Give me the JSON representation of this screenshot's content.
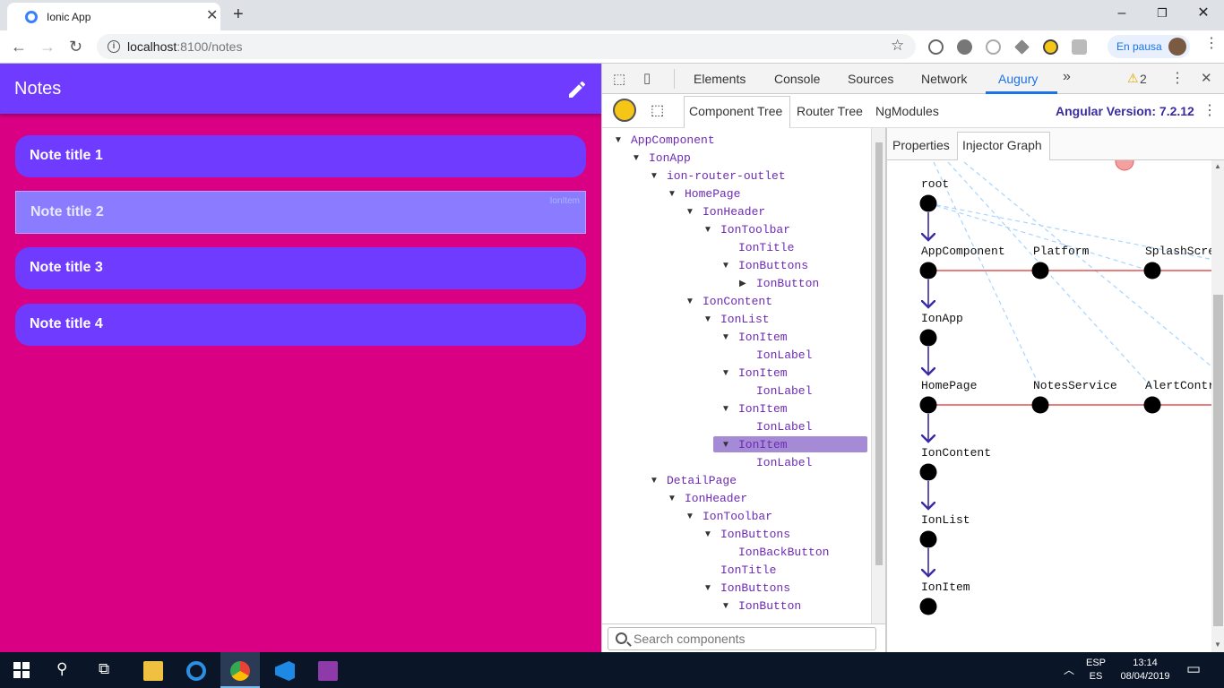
{
  "browser": {
    "tab_title": "Ionic App",
    "url_host": "localhost",
    "url_path": ":8100/notes",
    "profile_status": "En pausa"
  },
  "app": {
    "title": "Notes",
    "notes": [
      "Note title 1",
      "Note title 2",
      "Note title 3",
      "Note title 4"
    ],
    "highlight_tag": "IonItem",
    "colors": {
      "background": "#d90083",
      "toolbar": "#6f3bff",
      "item": "#6f3bff"
    }
  },
  "devtools": {
    "tabs": [
      "Elements",
      "Console",
      "Sources",
      "Network",
      "Augury"
    ],
    "active_tab": "Augury",
    "warning_count": "2",
    "augury_tabs": [
      "Component Tree",
      "Router Tree",
      "NgModules"
    ],
    "angular_version": "Angular Version: 7.2.12",
    "tree": [
      {
        "label": "AppComponent",
        "depth": 0,
        "toggle": "open"
      },
      {
        "label": "IonApp",
        "depth": 1,
        "toggle": "open"
      },
      {
        "label": "ion-router-outlet",
        "depth": 2,
        "toggle": "open"
      },
      {
        "label": "HomePage",
        "depth": 3,
        "toggle": "open"
      },
      {
        "label": "IonHeader",
        "depth": 4,
        "toggle": "open"
      },
      {
        "label": "IonToolbar",
        "depth": 5,
        "toggle": "open"
      },
      {
        "label": "IonTitle",
        "depth": 6,
        "toggle": "none"
      },
      {
        "label": "IonButtons",
        "depth": 6,
        "toggle": "open"
      },
      {
        "label": "IonButton",
        "depth": 7,
        "toggle": "closed"
      },
      {
        "label": "IonContent",
        "depth": 4,
        "toggle": "open"
      },
      {
        "label": "IonList",
        "depth": 5,
        "toggle": "open"
      },
      {
        "label": "IonItem",
        "depth": 6,
        "toggle": "open"
      },
      {
        "label": "IonLabel",
        "depth": 7,
        "toggle": "none"
      },
      {
        "label": "IonItem",
        "depth": 6,
        "toggle": "open"
      },
      {
        "label": "IonLabel",
        "depth": 7,
        "toggle": "none"
      },
      {
        "label": "IonItem",
        "depth": 6,
        "toggle": "open"
      },
      {
        "label": "IonLabel",
        "depth": 7,
        "toggle": "none"
      },
      {
        "label": "IonItem",
        "depth": 6,
        "toggle": "open",
        "selected": true
      },
      {
        "label": "IonLabel",
        "depth": 7,
        "toggle": "none"
      },
      {
        "label": "DetailPage",
        "depth": 2,
        "toggle": "open"
      },
      {
        "label": "IonHeader",
        "depth": 3,
        "toggle": "open"
      },
      {
        "label": "IonToolbar",
        "depth": 4,
        "toggle": "open"
      },
      {
        "label": "IonButtons",
        "depth": 5,
        "toggle": "open"
      },
      {
        "label": "IonBackButton",
        "depth": 6,
        "toggle": "none"
      },
      {
        "label": "IonTitle",
        "depth": 5,
        "toggle": "none"
      },
      {
        "label": "IonButtons",
        "depth": 5,
        "toggle": "open"
      },
      {
        "label": "IonButton",
        "depth": 6,
        "toggle": "open"
      }
    ],
    "search_placeholder": "Search components",
    "right_tabs": [
      "Properties",
      "Injector Graph"
    ],
    "graph": {
      "chain": [
        "root",
        "AppComponent",
        "IonApp",
        "HomePage",
        "IonContent",
        "IonList",
        "IonItem"
      ],
      "app_providers": [
        "Platform",
        "SplashScre"
      ],
      "home_providers": [
        "NotesService",
        "AlertContr"
      ]
    }
  },
  "taskbar": {
    "lang_top": "ESP",
    "lang_bottom": "ES",
    "time": "13:14",
    "date": "08/04/2019"
  }
}
